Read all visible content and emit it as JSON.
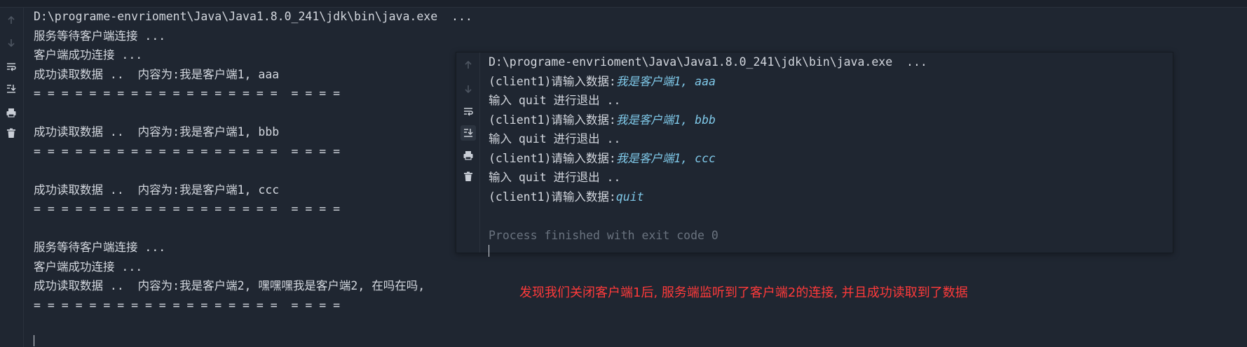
{
  "main_console": {
    "lines": [
      "D:\\programe-envrioment\\Java\\Java1.8.0_241\\jdk\\bin\\java.exe  ...",
      "服务等待客户端连接 ...",
      "客户端成功连接 ...",
      "成功读取数据 ..  内容为:我是客户端1, aaa",
      "= = = = = = = = = = = = = = = = = =  = = = =",
      "",
      "成功读取数据 ..  内容为:我是客户端1, bbb",
      "= = = = = = = = = = = = = = = = = =  = = = =",
      "",
      "成功读取数据 ..  内容为:我是客户端1, ccc",
      "= = = = = = = = = = = = = = = = = =  = = = =",
      "",
      "服务等待客户端连接 ...",
      "客户端成功连接 ...",
      "成功读取数据 ..  内容为:我是客户端2, 嘿嘿嘿我是客户端2, 在吗在吗,",
      "= = = = = = = = = = = = = = = = = =  = = = ="
    ]
  },
  "client_console": {
    "header": "D:\\programe-envrioment\\Java\\Java1.8.0_241\\jdk\\bin\\java.exe  ...",
    "prompt": "(client1)请输入数据:",
    "quit_hint": "输入 quit 进行退出 ..",
    "inputs": [
      "我是客户端1, aaa",
      "我是客户端1, bbb",
      "我是客户端1, ccc",
      "quit"
    ],
    "finished": "Process finished with exit code 0"
  },
  "annotation": "发现我们关闭客户端1后, 服务端监听到了客户端2的连接, 并且成功读取到了数据",
  "icons": [
    "up-arrow-icon",
    "down-arrow-icon",
    "soft-wrap-icon",
    "scroll-to-end-icon",
    "print-icon",
    "trash-icon"
  ],
  "colors": {
    "background": "#1f2631",
    "text": "#d3d7de",
    "user_input": "#7fc8e8",
    "process_finished": "#6a737f",
    "annotation": "#ff3a3a"
  }
}
